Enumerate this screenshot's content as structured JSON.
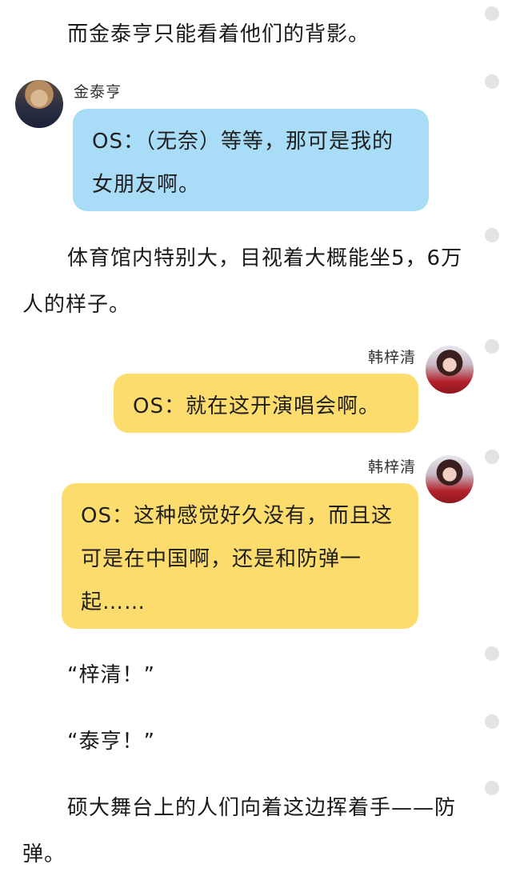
{
  "story": {
    "para1": "而金泰亨只能看着他们的背影。",
    "para2": "体育馆内特别大，目视着大概能坐5，6万人的样子。",
    "para3": "“梓清！”",
    "para4": "“泰亨！”",
    "para5": "硕大舞台上的人们向着这边挥着手——防弹。"
  },
  "messages": [
    {
      "speaker": "金泰亨",
      "side": "left",
      "color": "#a9dcf7",
      "text": "OS：（无奈）等等，那可是我的女朋友啊。"
    },
    {
      "speaker": "韩梓清",
      "side": "right",
      "color": "#fcdc6c",
      "text": "OS：就在这开演唱会啊。"
    },
    {
      "speaker": "韩梓清",
      "side": "right",
      "color": "#fcdc6c",
      "text": "OS：这种感觉好久没有，而且这可是在中国啊，还是和防弹一起……"
    }
  ]
}
